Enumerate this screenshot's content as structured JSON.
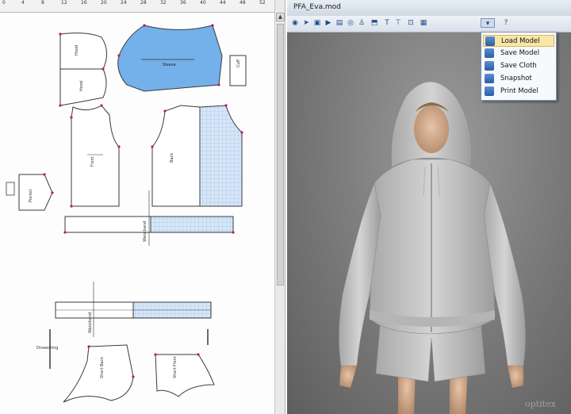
{
  "pattern_editor": {
    "ruler_ticks": [
      "0",
      "4",
      "8",
      "12",
      "16",
      "20",
      "24",
      "28",
      "32",
      "36",
      "40",
      "44",
      "48",
      "52"
    ],
    "pattern_labels": [
      "Hood",
      "Hood",
      "Sleeve",
      "Cuff",
      "Front",
      "Back",
      "Pocket",
      "Waistband",
      "Waistband",
      "Drawstring",
      "Short Back",
      "Short Front"
    ]
  },
  "viewer": {
    "title": "PFA_Eva.mod",
    "toolbar_icons": [
      "globe-icon",
      "arrow-icon",
      "save-icon",
      "play-icon",
      "cloth-icon",
      "eye-icon",
      "mannequin-icon",
      "shirt-icon",
      "text-icon",
      "measure-icon",
      "camera-icon",
      "grid-icon",
      "model-menu-icon",
      "help-icon"
    ],
    "watermark": "optitex",
    "menu": {
      "items": [
        {
          "label": "Load Model",
          "selected": true
        },
        {
          "label": "Save Model",
          "selected": false
        },
        {
          "label": "Save Cloth",
          "selected": false
        },
        {
          "label": "Snapshot",
          "selected": false
        },
        {
          "label": "Print Model",
          "selected": false
        }
      ]
    }
  },
  "colors": {
    "sleeve_fill": "#74b0ea",
    "grid_fill": "#cfe2f7",
    "pattern_line": "#3a3a3a",
    "point_marker": "#c2185b",
    "menu_highlight": "#f8e6a8"
  }
}
